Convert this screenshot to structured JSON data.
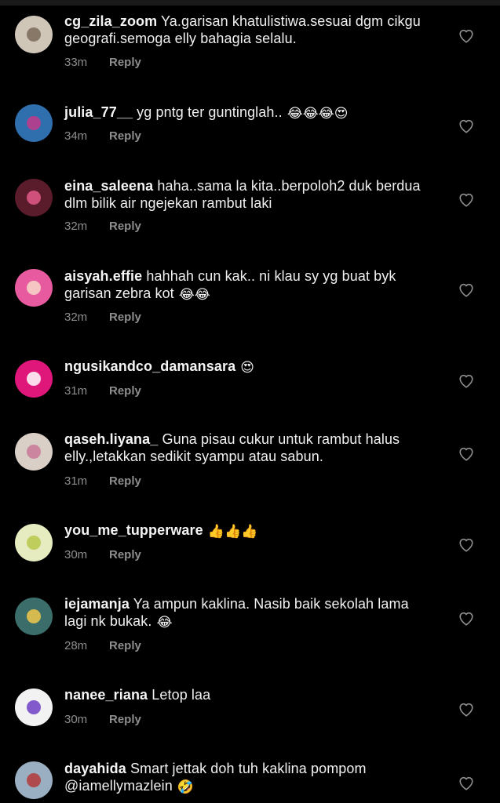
{
  "theme": {
    "background": "#000000",
    "text": "#f5f5f5",
    "muted": "#8e8e8e"
  },
  "comments": [
    {
      "username": "cg_zila_zoom",
      "text": "Ya.garisan khatulistiwa.sesuai dgm cikgu geografi.semoga elly bahagia selalu.",
      "emoji": "",
      "time": "33m",
      "reply_label": "Reply",
      "avatar_color": "#cfc6b8",
      "avatar_accent": "#7a6a58",
      "like_icon": "heart-outline-icon"
    },
    {
      "username": "julia_77__",
      "text": "yg pntg ter guntinglah..",
      "emoji": "😂😂😂😍",
      "time": "34m",
      "reply_label": "Reply",
      "avatar_color": "#2f6fae",
      "avatar_accent": "#c23a8a",
      "like_icon": "heart-outline-icon"
    },
    {
      "username": "eina_saleena",
      "text": "haha..sama la kita..berpoloh2 duk berdua dlm bilik air ngejekan rambut laki",
      "emoji": "",
      "time": "32m",
      "reply_label": "Reply",
      "avatar_color": "#5a1b2a",
      "avatar_accent": "#e45a8a",
      "like_icon": "heart-outline-icon"
    },
    {
      "username": "aisyah.effie",
      "text": "hahhah cun kak.. ni klau sy yg buat byk garisan zebra kot",
      "emoji": "😂😂",
      "time": "32m",
      "reply_label": "Reply",
      "avatar_color": "#e85aa0",
      "avatar_accent": "#f6d8c8",
      "like_icon": "heart-outline-icon"
    },
    {
      "username": "ngusikandco_damansara",
      "text": "",
      "emoji": "😍",
      "time": "31m",
      "reply_label": "Reply",
      "avatar_color": "#e0177a",
      "avatar_accent": "#ffffff",
      "like_icon": "heart-outline-icon"
    },
    {
      "username": "qaseh.liyana_",
      "text": "Guna pisau cukur untuk rambut halus elly.,letakkan sedikit syampu atau sabun.",
      "emoji": "",
      "time": "31m",
      "reply_label": "Reply",
      "avatar_color": "#d9cfc6",
      "avatar_accent": "#c87896",
      "like_icon": "heart-outline-icon"
    },
    {
      "username": "you_me_tupperware",
      "text": "",
      "emoji": "👍👍👍",
      "time": "30m",
      "reply_label": "Reply",
      "avatar_color": "#e6ecc0",
      "avatar_accent": "#b6c84a",
      "like_icon": "heart-outline-icon"
    },
    {
      "username": "iejamanja",
      "text": "Ya ampun kaklina. Nasib baik sekolah lama lagi nk bukak.",
      "emoji": "😂",
      "time": "28m",
      "reply_label": "Reply",
      "avatar_color": "#3b6d6a",
      "avatar_accent": "#f1c84a",
      "like_icon": "heart-outline-icon"
    },
    {
      "username": "nanee_riana",
      "text": "Letop laa",
      "emoji": "",
      "time": "30m",
      "reply_label": "Reply",
      "avatar_color": "#f2f2f2",
      "avatar_accent": "#6f3fc6",
      "like_icon": "heart-outline-icon"
    },
    {
      "username": "dayahida",
      "text": "Smart jettak doh tuh kaklina pompom @iamellymazlein",
      "emoji": "🤣",
      "time": "",
      "reply_label": "",
      "avatar_color": "#9ab0c2",
      "avatar_accent": "#b33a3a",
      "like_icon": "heart-outline-icon"
    }
  ]
}
